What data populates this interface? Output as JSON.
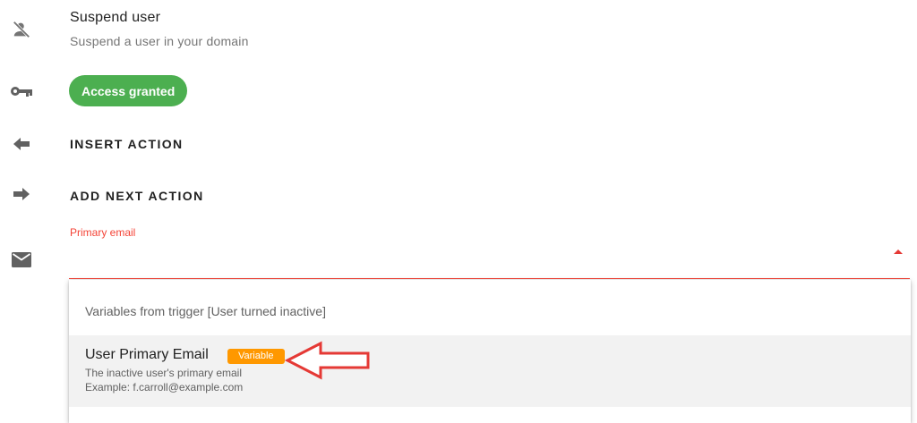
{
  "step": {
    "title": "Suspend user",
    "subtitle": "Suspend a user in your domain",
    "icon": "person-off-icon"
  },
  "access": {
    "label": "Access granted",
    "color": "#4caf50",
    "icon": "key-icon"
  },
  "actions": [
    {
      "label": "INSERT ACTION",
      "icon": "arrow-left-icon"
    },
    {
      "label": "ADD NEXT ACTION",
      "icon": "arrow-right-icon"
    }
  ],
  "field": {
    "label": "Primary email",
    "icon": "mail-icon",
    "error_color": "#f44336",
    "dropdown": {
      "group_header": "Variables from trigger [User turned inactive]",
      "options": [
        {
          "name": "User Primary Email",
          "badge": "Variable",
          "badge_color": "#ff9800",
          "description": "The inactive user's primary email",
          "example": "Example: f.carroll@example.com"
        }
      ]
    }
  },
  "annotation": {
    "color": "#e53935",
    "icon": "red-arrow-pointer"
  }
}
